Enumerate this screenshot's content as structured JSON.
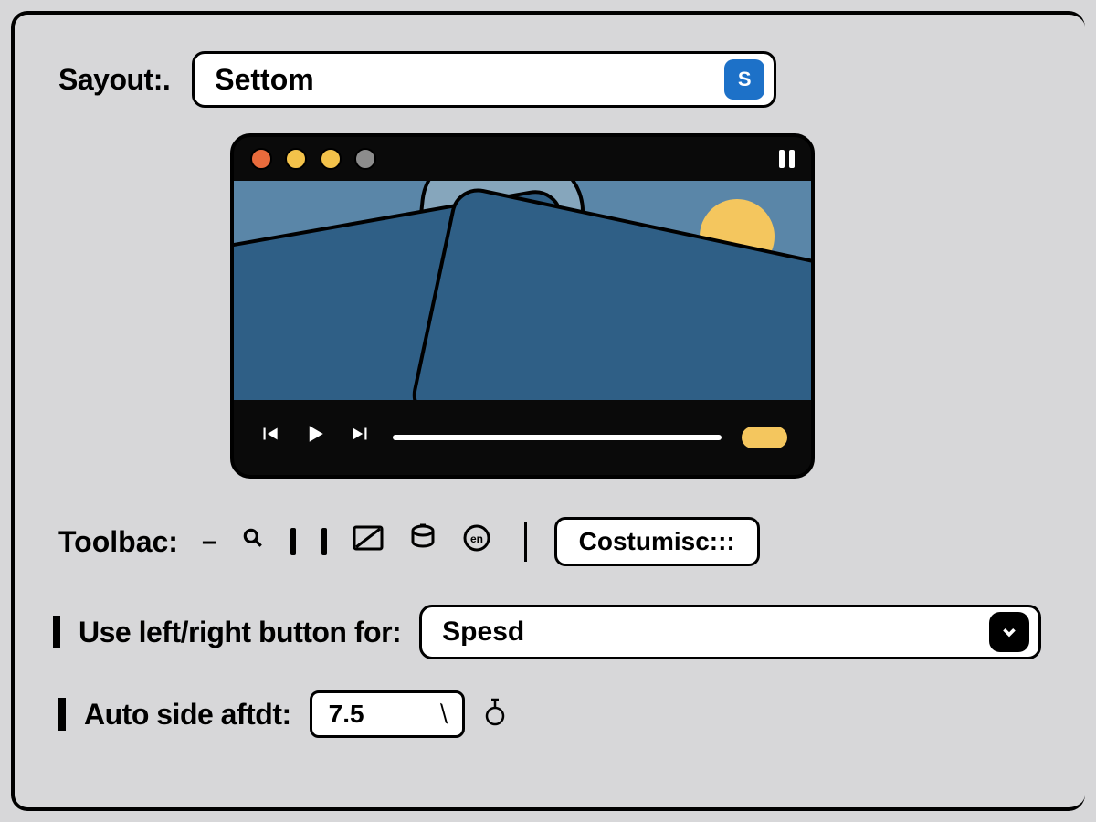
{
  "layout": {
    "label": "Sayout:.",
    "value": "Settom",
    "badge_glyph": "S"
  },
  "player_preview": {
    "window_dots": [
      "red",
      "yellow",
      "yellow",
      "grey"
    ],
    "control_icons": {
      "prev": "prev-icon",
      "play": "play-icon",
      "next": "next-icon"
    }
  },
  "toolbar_row": {
    "label": "Toolbac:",
    "dash": "–",
    "icons": [
      "search-icon",
      "bar-icon",
      "bar-icon",
      "box-icon",
      "stack-icon",
      "circle-icon"
    ],
    "customise_label": "Costumisc:::"
  },
  "left_right_row": {
    "label": "Use left/right button for:",
    "value": "Spesd"
  },
  "auto_hide_row": {
    "label": "Auto side aftdt:",
    "value": "7.5",
    "suffix_icon": "seconds-icon"
  },
  "colors": {
    "accent_blue": "#1d71c8",
    "accent_yellow": "#f4c65e",
    "panel_bg": "#d7d7d9"
  }
}
